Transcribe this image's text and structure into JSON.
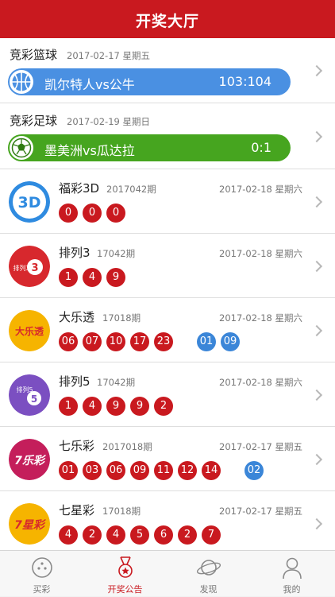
{
  "header": {
    "title": "开奖大厅"
  },
  "sports": [
    {
      "title": "竞彩篮球",
      "date": "2017-02-17 星期五",
      "match": "凯尔特人vs公牛",
      "score": "103:104",
      "color": "#4a90e2",
      "icon": "basketball-icon"
    },
    {
      "title": "竞彩足球",
      "date": "2017-02-19 星期日",
      "match": "墨美洲vs瓜达拉",
      "score": "0:1",
      "color": "#46a51f",
      "icon": "soccer-ball-icon"
    }
  ],
  "lotteries": [
    {
      "name": "福彩3D",
      "issue": "2017042期",
      "date": "2017-02-18 星期六",
      "red": [
        "0",
        "0",
        "0"
      ],
      "blue": [],
      "logo": "fucai-3d-logo",
      "logo_text": "3D"
    },
    {
      "name": "排列3",
      "issue": "17042期",
      "date": "2017-02-18 星期六",
      "red": [
        "1",
        "4",
        "9"
      ],
      "blue": [],
      "logo": "pailie3-logo",
      "logo_text": "排列3"
    },
    {
      "name": "大乐透",
      "issue": "17018期",
      "date": "2017-02-18 星期六",
      "red": [
        "06",
        "07",
        "10",
        "17",
        "23"
      ],
      "blue": [
        "01",
        "09"
      ],
      "logo": "daletou-logo",
      "logo_text": "大乐透"
    },
    {
      "name": "排列5",
      "issue": "17042期",
      "date": "2017-02-18 星期六",
      "red": [
        "1",
        "4",
        "9",
        "9",
        "2"
      ],
      "blue": [],
      "logo": "pailie5-logo",
      "logo_text": "排列5"
    },
    {
      "name": "七乐彩",
      "issue": "2017018期",
      "date": "2017-02-17 星期五",
      "red": [
        "01",
        "03",
        "06",
        "09",
        "11",
        "12",
        "14"
      ],
      "blue": [
        "02"
      ],
      "logo": "qilecai-logo",
      "logo_text": "7乐彩"
    },
    {
      "name": "七星彩",
      "issue": "17018期",
      "date": "2017-02-17 星期五",
      "red": [
        "4",
        "2",
        "4",
        "5",
        "6",
        "2",
        "7"
      ],
      "blue": [],
      "logo": "qixingcai-logo",
      "logo_text": "7星彩"
    }
  ],
  "tabs": [
    {
      "label": "买彩",
      "icon": "ball-icon",
      "active": false
    },
    {
      "label": "开奖公告",
      "icon": "medal-icon",
      "active": true
    },
    {
      "label": "发现",
      "icon": "planet-icon",
      "active": false
    },
    {
      "label": "我的",
      "icon": "person-icon",
      "active": false
    }
  ],
  "colors": {
    "brand": "#c9191f",
    "ball_red": "#c9191f",
    "ball_blue": "#3b86d8"
  }
}
